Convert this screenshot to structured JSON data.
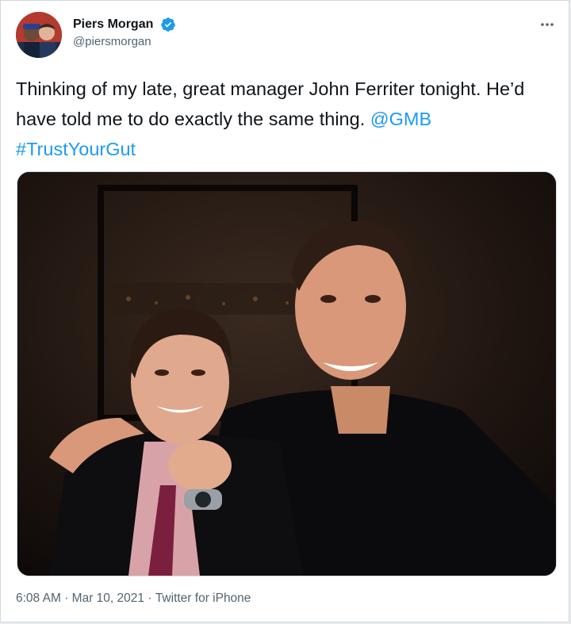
{
  "tweet": {
    "author_name": "Piers Morgan",
    "author_handle": "@piersmorgan",
    "more_icon": "more-horizontal-icon",
    "text_plain": "Thinking of my late, great manager John Ferriter tonight. He’d have told me to do exactly the same thing.",
    "mention": "@GMB",
    "hashtag": "#TrustYourGut",
    "time": "6:08 AM",
    "date": "Mar 10, 2021",
    "source": "Twitter for iPhone",
    "separator": "·"
  },
  "colors": {
    "link": "#1d9bf0",
    "verified": "#1d9bf0",
    "text": "#0f1419",
    "secondary": "#536471"
  }
}
